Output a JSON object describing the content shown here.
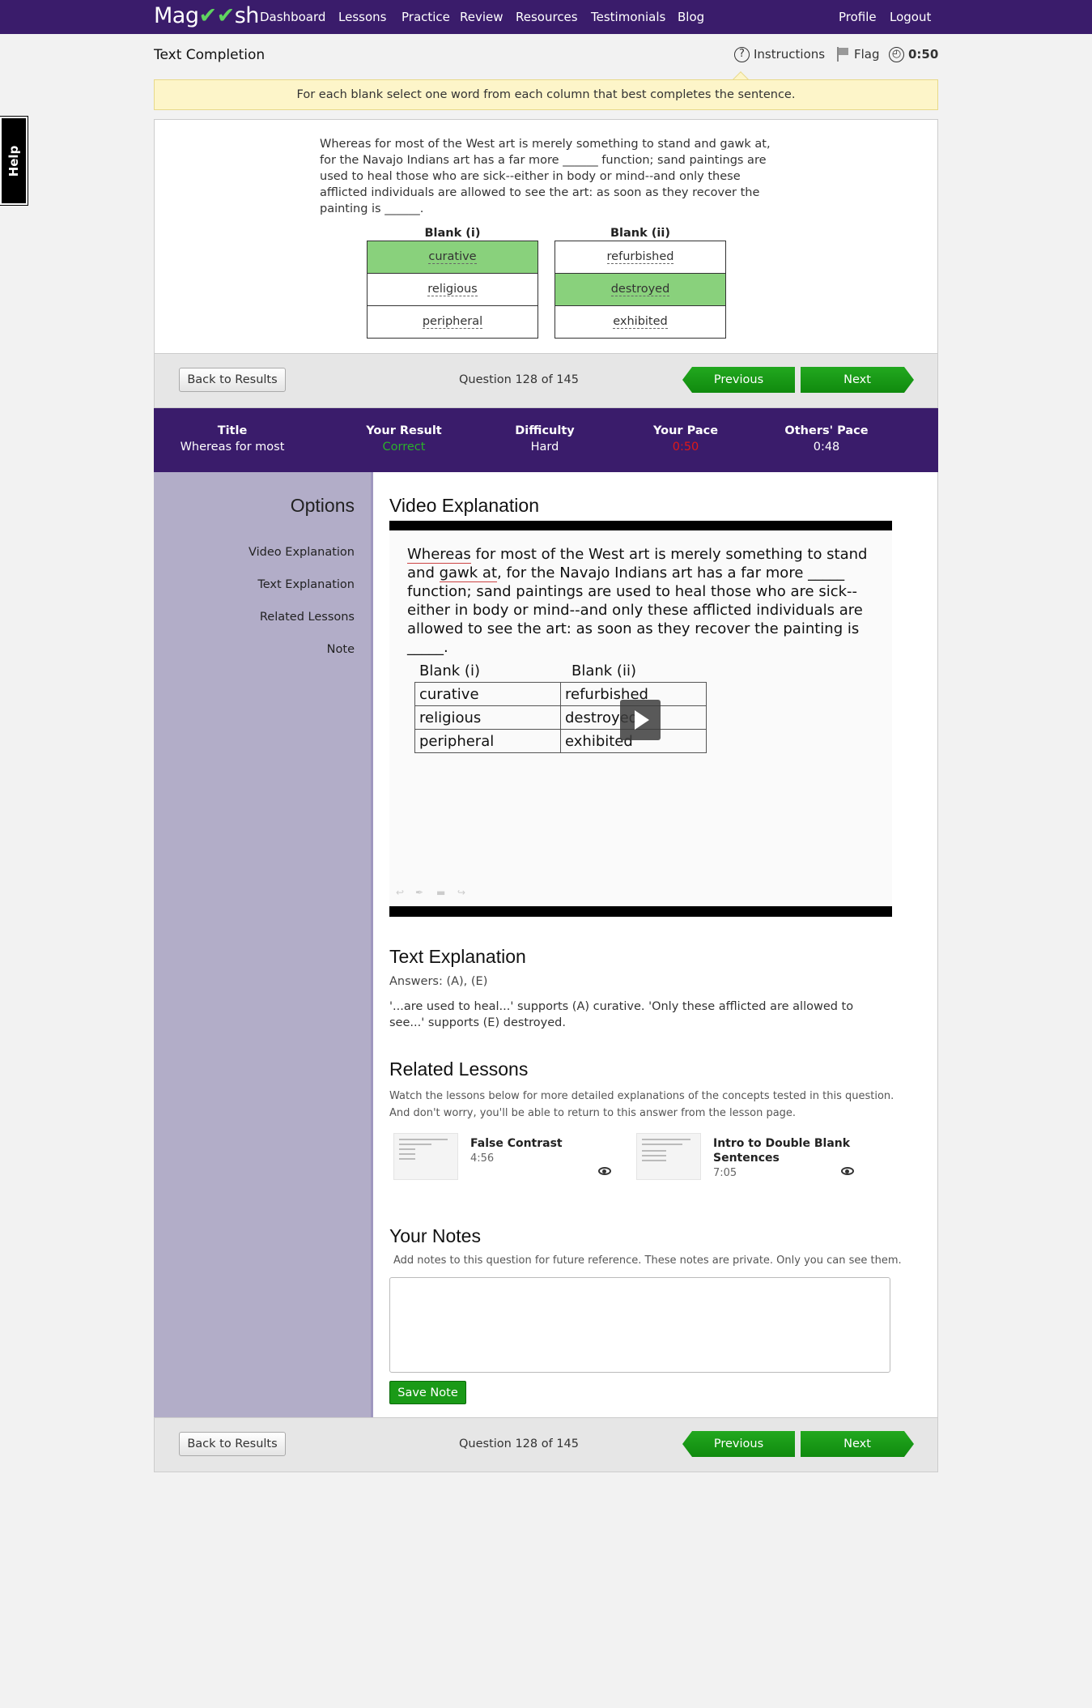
{
  "nav": {
    "brand_left": "Mag",
    "brand_mark": "✔✔",
    "brand_right": "sh",
    "links": [
      "Dashboard",
      "Lessons",
      "Practice",
      "Review",
      "Resources",
      "Testimonials",
      "Blog"
    ],
    "profile": "Profile",
    "logout": "Logout"
  },
  "help_label": "Help",
  "header": {
    "question_type": "Text Completion",
    "instructions_label": "Instructions",
    "flag_label": "Flag",
    "timer": "0:50"
  },
  "instructions_text": "For each blank select one word from each column that best completes the sentence.",
  "question": {
    "text": "Whereas for most of the West art is merely something to stand and gawk at, for the Navajo Indians art has a far more ______ function; sand paintings are used to heal those who are sick--either in body or mind--and only these afflicted individuals are allowed to see the art: as soon as they recover the painting is ______.",
    "blank1": {
      "title": "Blank (i)",
      "options": [
        "curative",
        "religious",
        "peripheral"
      ],
      "selected": 0
    },
    "blank2": {
      "title": "Blank (ii)",
      "options": [
        "refurbished",
        "destroyed",
        "exhibited"
      ],
      "selected": 1
    }
  },
  "navbar": {
    "back_label": "Back to Results",
    "count": "Question 128 of 145",
    "prev_label": "Previous",
    "next_label": "Next"
  },
  "stats": {
    "title_label": "Title",
    "title_value": "Whereas for most",
    "result_label": "Your Result",
    "result_value": "Correct",
    "difficulty_label": "Difficulty",
    "difficulty_value": "Hard",
    "pace_label": "Your Pace",
    "pace_value": "0:50",
    "others_label": "Others' Pace",
    "others_value": "0:48",
    "colors": {
      "correct": "#2bb02b",
      "pace": "#e01818"
    }
  },
  "sidebar": {
    "title": "Options",
    "items": [
      "Video Explanation",
      "Text Explanation",
      "Related Lessons",
      "Note"
    ]
  },
  "video": {
    "title": "Video Explanation",
    "text_part1": "Whereas",
    "text_part2": " for most of the West art is merely something to stand and ",
    "text_part3": "gawk at",
    "text_part4": ", for the Navajo Indians art has a far more _____ function; sand paintings are used to heal those who are sick--either in body or mind--and only these afflicted individuals are allowed to see the art: as soon as they recover the painting is _____.",
    "blank1_title": "Blank (i)",
    "blank2_title": "Blank (ii)",
    "col1": [
      "curative",
      "religious",
      "peripheral"
    ],
    "col2": [
      "refurbished",
      "destroyed",
      "exhibited"
    ]
  },
  "text_explanation": {
    "title": "Text Explanation",
    "answers": "Answers: (A), (E)",
    "body": "'...are used to heal...' supports (A) curative. 'Only these afflicted are allowed to see...' supports (E) destroyed."
  },
  "related": {
    "title": "Related Lessons",
    "desc": "Watch the lessons below for more detailed explanations of the concepts tested in this question. And don't worry, you'll be able to return to this answer from the lesson page.",
    "lessons": [
      {
        "title": "False Contrast",
        "time": "4:56"
      },
      {
        "title": "Intro to Double Blank Sentences",
        "time": "7:05"
      }
    ]
  },
  "notes": {
    "title": "Your Notes",
    "desc": "Add notes to this question for future reference. These notes are private. Only you can see them.",
    "value": "",
    "save_label": "Save Note"
  }
}
